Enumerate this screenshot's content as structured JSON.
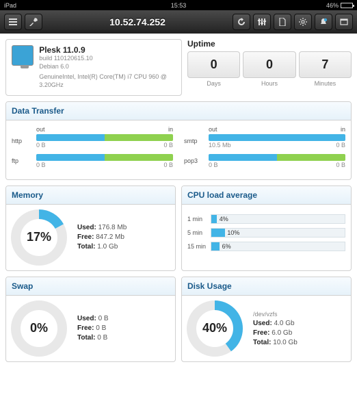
{
  "statusbar": {
    "device": "iPad",
    "time": "15:53",
    "battery": "46%"
  },
  "navbar": {
    "title": "10.52.74.252"
  },
  "system": {
    "product": "Plesk 11.0.9",
    "build": "build 110120615.10",
    "distro": "Debian 6.0",
    "cpu": "GenuineIntel, Intel(R) Core(TM) i7 CPU 960  @ 3.20GHz"
  },
  "uptime": {
    "title": "Uptime",
    "days": {
      "value": "0",
      "label": "Days"
    },
    "hours": {
      "value": "0",
      "label": "Hours"
    },
    "minutes": {
      "value": "7",
      "label": "Minutes"
    }
  },
  "dataTransfer": {
    "title": "Data Transfer",
    "outLabel": "out",
    "inLabel": "in",
    "left": [
      {
        "proto": "http",
        "out": "0 B",
        "in": "0 B",
        "outPct": 50,
        "inPct": 50
      },
      {
        "proto": "ftp",
        "out": "0 B",
        "in": "0 B",
        "outPct": 50,
        "inPct": 50
      }
    ],
    "right": [
      {
        "proto": "smtp",
        "out": "10.5 Mb",
        "in": "0 B",
        "outPct": 100,
        "inPct": 0
      },
      {
        "proto": "pop3",
        "out": "0 B",
        "in": "0 B",
        "outPct": 50,
        "inPct": 50
      }
    ]
  },
  "memory": {
    "title": "Memory",
    "pct": 17,
    "pctLabel": "17%",
    "used": "176.8 Mb",
    "free": "847.2 Mb",
    "total": "1.0 Gb",
    "usedLabel": "Used:",
    "freeLabel": "Free:",
    "totalLabel": "Total:"
  },
  "cpu": {
    "title": "CPU load average",
    "rows": [
      {
        "label": "1 min",
        "pct": 4,
        "pctLabel": "4%"
      },
      {
        "label": "5 min",
        "pct": 10,
        "pctLabel": "10%"
      },
      {
        "label": "15 min",
        "pct": 6,
        "pctLabel": "6%"
      }
    ]
  },
  "swap": {
    "title": "Swap",
    "pct": 0,
    "pctLabel": "0%",
    "used": "0 B",
    "free": "0 B",
    "total": "0 B",
    "usedLabel": "Used:",
    "freeLabel": "Free:",
    "totalLabel": "Total:"
  },
  "disk": {
    "title": "Disk Usage",
    "pct": 40,
    "pctLabel": "40%",
    "path": "/dev/vzfs",
    "used": "4.0 Gb",
    "free": "6.0 Gb",
    "total": "10.0 Gb",
    "usedLabel": "Used:",
    "freeLabel": "Free:",
    "totalLabel": "Total:"
  },
  "chart_data": [
    {
      "type": "pie",
      "title": "Memory",
      "values": [
        17,
        83
      ],
      "categories": [
        "Used %",
        "Free %"
      ]
    },
    {
      "type": "bar",
      "title": "CPU load average",
      "categories": [
        "1 min",
        "5 min",
        "15 min"
      ],
      "values": [
        4,
        10,
        6
      ],
      "ylabel": "%",
      "ylim": [
        0,
        100
      ]
    },
    {
      "type": "pie",
      "title": "Swap",
      "values": [
        0,
        100
      ],
      "categories": [
        "Used %",
        "Free %"
      ]
    },
    {
      "type": "pie",
      "title": "Disk Usage",
      "values": [
        40,
        60
      ],
      "categories": [
        "Used %",
        "Free %"
      ]
    }
  ]
}
